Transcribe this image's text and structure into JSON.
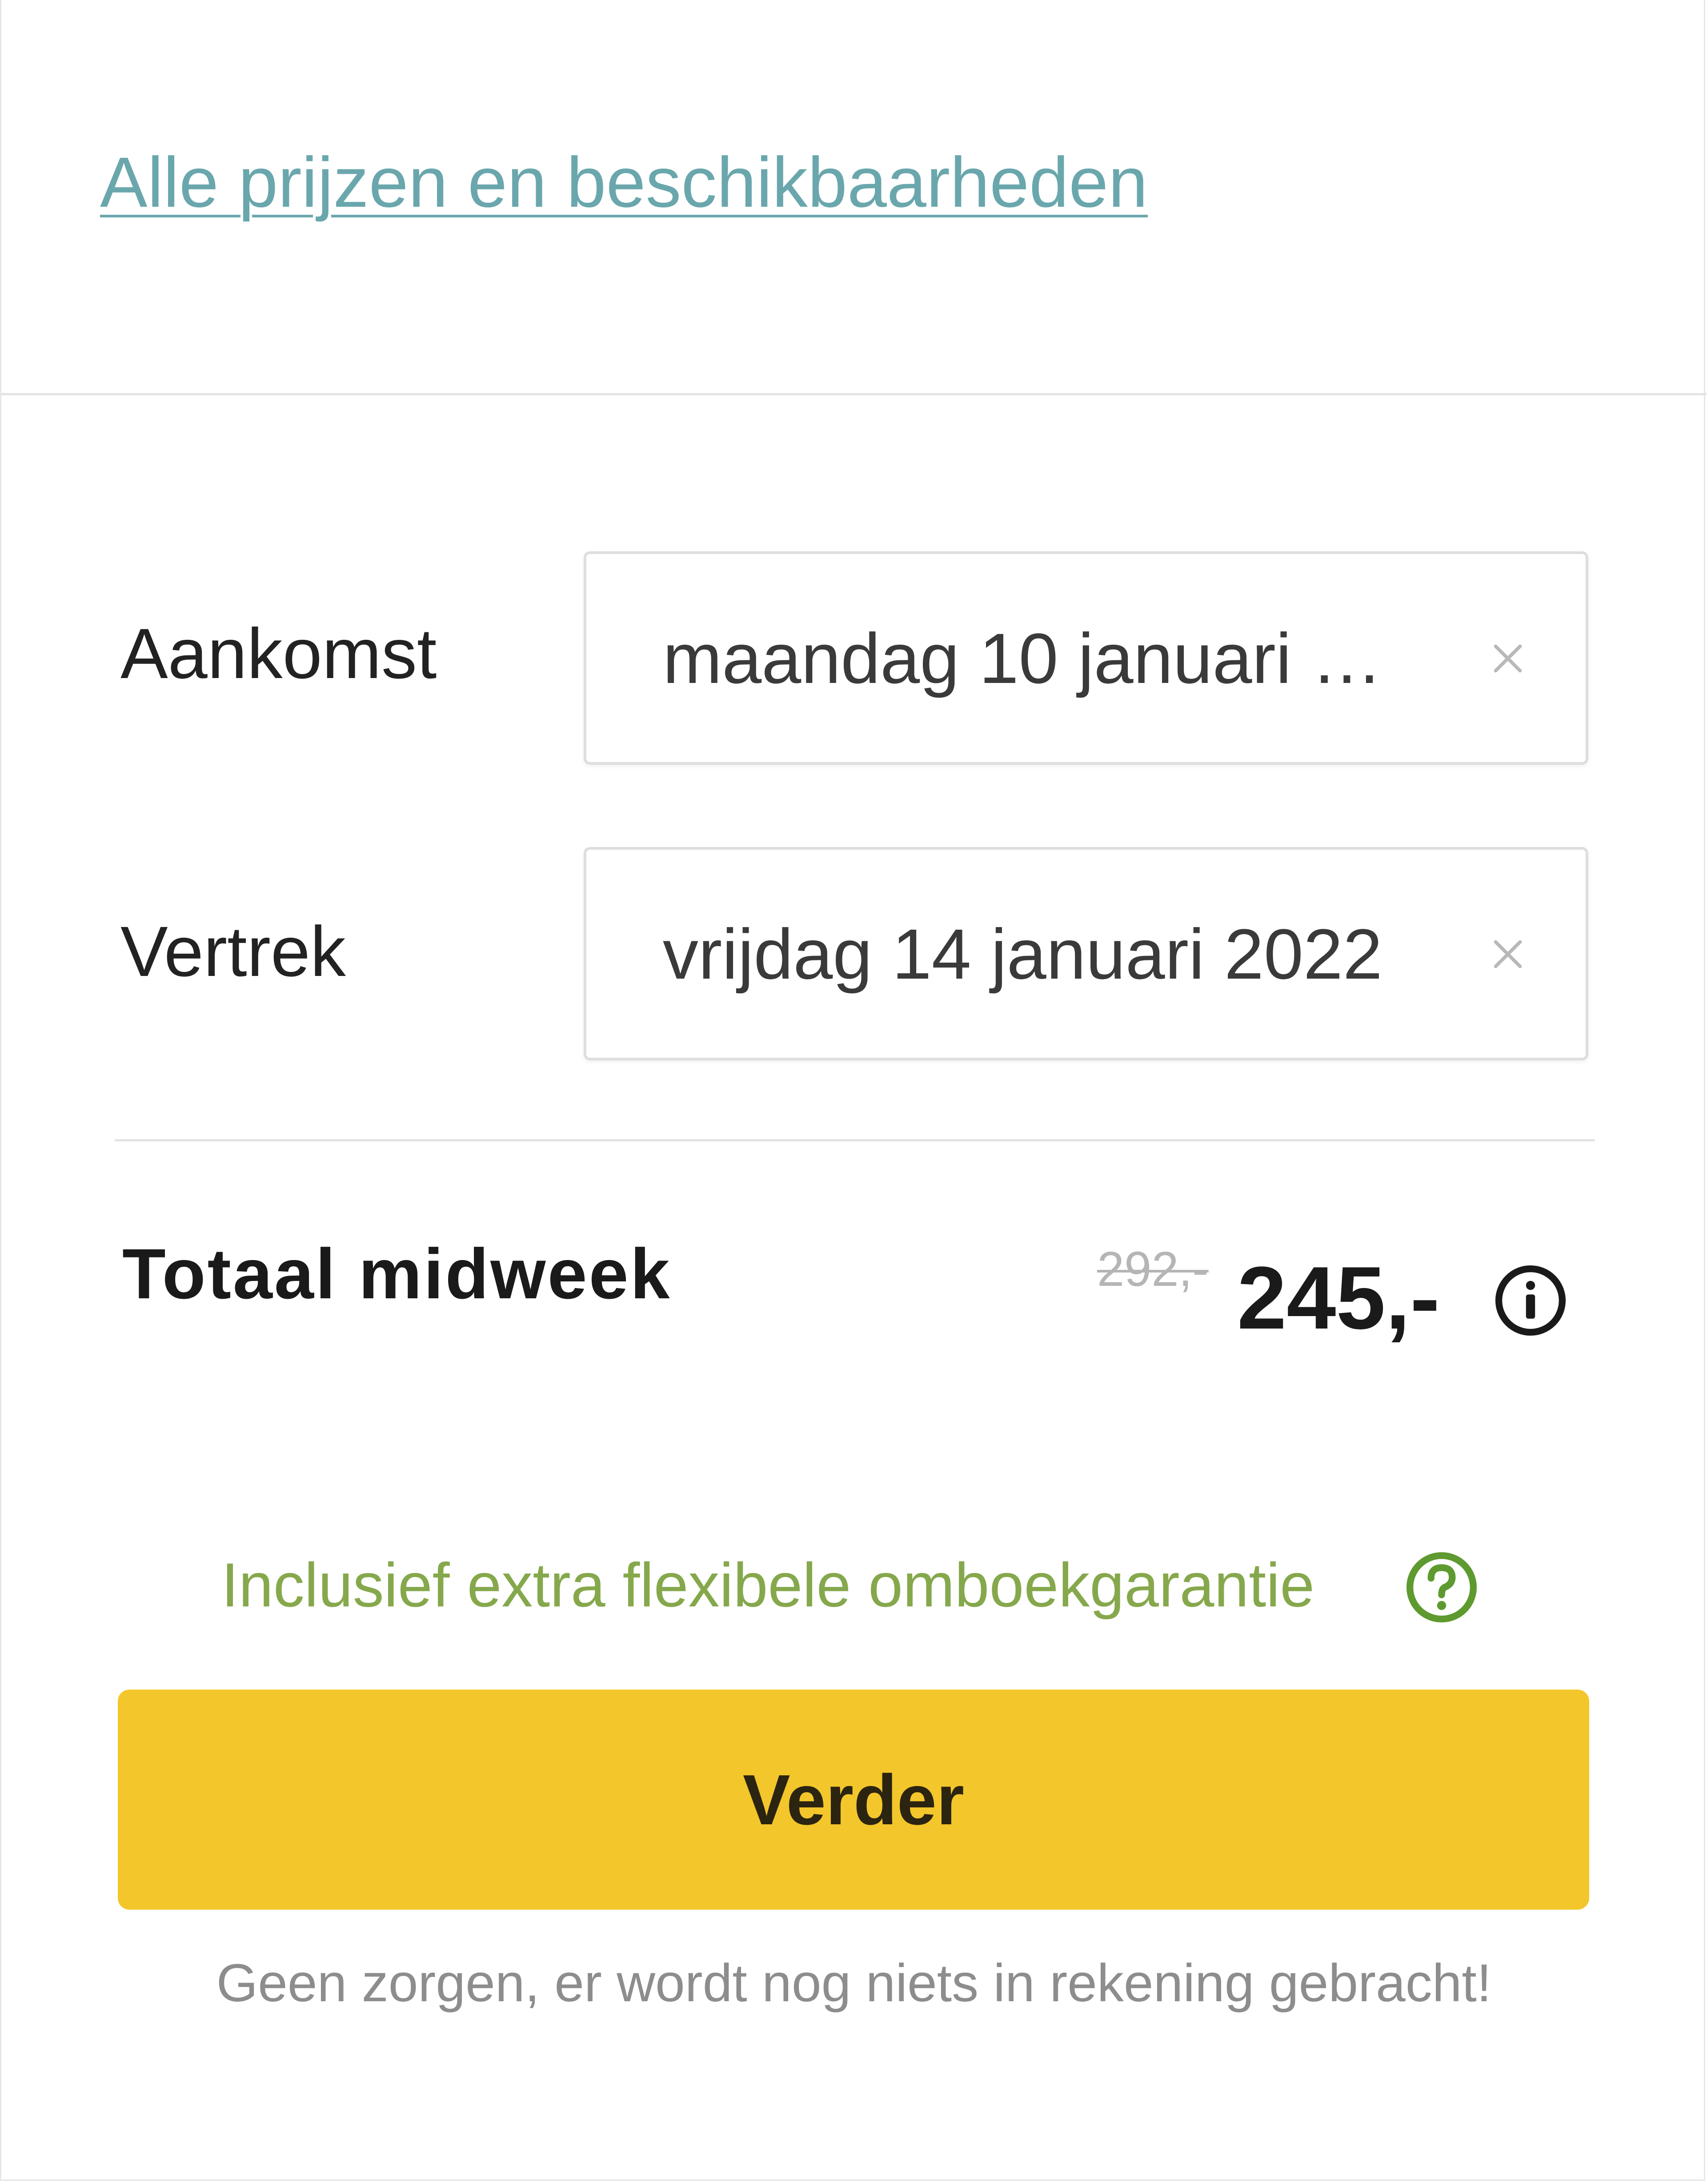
{
  "availability_link": {
    "label": "Alle prijzen en beschikbaarheden"
  },
  "dates": {
    "arrival": {
      "label": "Aankomst",
      "value": "maandag 10 januari 2…",
      "clear_icon": "close-icon"
    },
    "departure": {
      "label": "Vertrek",
      "value": "vrijdag 14 januari 2022",
      "clear_icon": "close-icon"
    }
  },
  "total": {
    "label": "Totaal midweek",
    "old_price": "292,-",
    "price": "245,-",
    "info_icon": "info-circle-icon"
  },
  "guarantee": {
    "text": "Inclusief extra flexibele omboekgarantie",
    "help_icon": "question-circle-icon"
  },
  "continue_button": {
    "label": "Verder"
  },
  "footnote": "Geen zorgen, er wordt nog niets in rekening gebracht!",
  "colors": {
    "link": "#6aa7ad",
    "accent_button": "#f3c62b",
    "guarantee_green": "#86a84c",
    "old_price_gray": "#b5b5b5"
  }
}
